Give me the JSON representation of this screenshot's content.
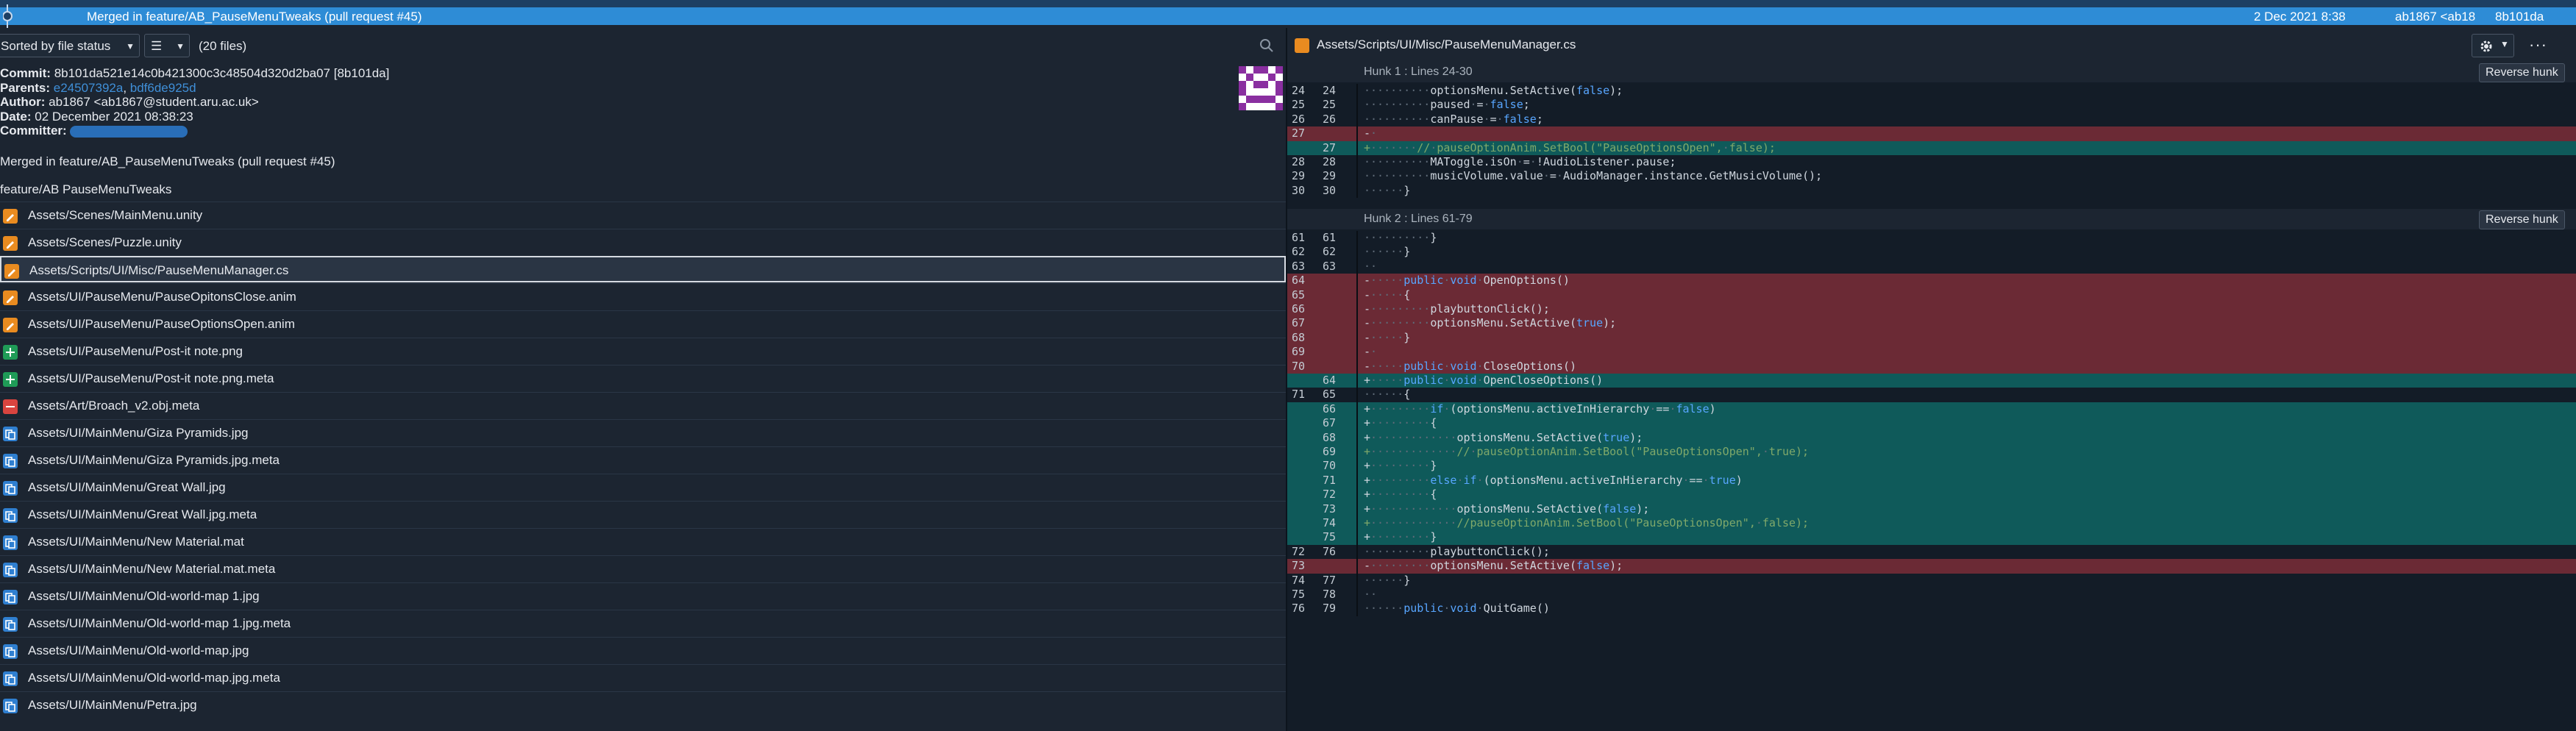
{
  "top_strip": {
    "text": "Merged in feature/AB_PauseMenuTweaks ... for commit ..."
  },
  "commit_bar": {
    "message": "Merged in feature/AB_PauseMenuTweaks (pull request #45)",
    "date": "2 Dec 2021 8:38",
    "author": "ab1867 <ab18",
    "hash": "8b101da"
  },
  "left": {
    "sort_label": "Sorted by file status",
    "view_icon": "list-view-icon",
    "file_count": "(20 files)",
    "meta": {
      "commit_label": "Commit:",
      "commit_value": "8b101da521e14c0b421300c3c48504d320d2ba07 [8b101da]",
      "parents_label": "Parents:",
      "parent1": "e24507392a",
      "parent2": "bdf6de925d",
      "author_label": "Author:",
      "author_value": "ab1867 <ab1867@student.aru.ac.uk>",
      "date_label": "Date:",
      "date_value": "02 December 2021 08:38:23",
      "committer_label": "Committer:"
    },
    "commit_message": "Merged in feature/AB_PauseMenuTweaks (pull request #45)",
    "branch_line": "feature/AB PauseMenuTweaks",
    "files": [
      {
        "status": "modified",
        "name": "Assets/Scenes/MainMenu.unity"
      },
      {
        "status": "modified",
        "name": "Assets/Scenes/Puzzle.unity"
      },
      {
        "status": "modified",
        "name": "Assets/Scripts/UI/Misc/PauseMenuManager.cs"
      },
      {
        "status": "modified",
        "name": "Assets/UI/PauseMenu/PauseOpitonsClose.anim"
      },
      {
        "status": "modified",
        "name": "Assets/UI/PauseMenu/PauseOptionsOpen.anim"
      },
      {
        "status": "added",
        "name": "Assets/UI/PauseMenu/Post-it note.png"
      },
      {
        "status": "added",
        "name": "Assets/UI/PauseMenu/Post-it note.png.meta"
      },
      {
        "status": "removed",
        "name": "Assets/Art/Broach_v2.obj.meta"
      },
      {
        "status": "renamed",
        "name": "Assets/UI/MainMenu/Giza Pyramids.jpg"
      },
      {
        "status": "renamed",
        "name": "Assets/UI/MainMenu/Giza Pyramids.jpg.meta"
      },
      {
        "status": "renamed",
        "name": "Assets/UI/MainMenu/Great Wall.jpg"
      },
      {
        "status": "renamed",
        "name": "Assets/UI/MainMenu/Great Wall.jpg.meta"
      },
      {
        "status": "renamed",
        "name": "Assets/UI/MainMenu/New Material.mat"
      },
      {
        "status": "renamed",
        "name": "Assets/UI/MainMenu/New Material.mat.meta"
      },
      {
        "status": "renamed",
        "name": "Assets/UI/MainMenu/Old-world-map 1.jpg"
      },
      {
        "status": "renamed",
        "name": "Assets/UI/MainMenu/Old-world-map 1.jpg.meta"
      },
      {
        "status": "renamed",
        "name": "Assets/UI/MainMenu/Old-world-map.jpg"
      },
      {
        "status": "renamed",
        "name": "Assets/UI/MainMenu/Old-world-map.jpg.meta"
      },
      {
        "status": "renamed",
        "name": "Assets/UI/MainMenu/Petra.jpg"
      }
    ],
    "selected_index": 2
  },
  "right": {
    "file_path": "Assets/Scripts/UI/Misc/PauseMenuManager.cs",
    "settings_icon": "gear-icon",
    "more_label": "···",
    "hunks": [
      {
        "title": "Hunk 1 : Lines 24-30",
        "button": "Reverse hunk",
        "lines": [
          {
            "t": "ctx",
            "o": "24",
            "n": "24",
            "c": "··········optionsMenu.SetActive(false);"
          },
          {
            "t": "ctx",
            "o": "25",
            "n": "25",
            "c": "··········paused·=·false;"
          },
          {
            "t": "ctx",
            "o": "26",
            "n": "26",
            "c": "··········canPause·=·false;"
          },
          {
            "t": "del",
            "o": "27",
            "n": "",
            "c": "-·"
          },
          {
            "t": "add",
            "o": "",
            "n": "27",
            "c": "+·······//·pauseOptionAnim.SetBool(\"PauseOptionsOpen\",·false);"
          },
          {
            "t": "ctx",
            "o": "28",
            "n": "28",
            "c": "··········MAToggle.isOn·=·!AudioListener.pause;"
          },
          {
            "t": "ctx",
            "o": "29",
            "n": "29",
            "c": "··········musicVolume.value·=·AudioManager.instance.GetMusicVolume();"
          },
          {
            "t": "ctx",
            "o": "30",
            "n": "30",
            "c": "······}"
          }
        ]
      },
      {
        "title": "Hunk 2 : Lines 61-79",
        "button": "Reverse hunk",
        "lines": [
          {
            "t": "ctx",
            "o": "61",
            "n": "61",
            "c": "··········}"
          },
          {
            "t": "ctx",
            "o": "62",
            "n": "62",
            "c": "······}"
          },
          {
            "t": "ctx",
            "o": "63",
            "n": "63",
            "c": "··"
          },
          {
            "t": "del",
            "o": "64",
            "n": "",
            "c": "-·····public·void·OpenOptions()"
          },
          {
            "t": "del",
            "o": "65",
            "n": "",
            "c": "-·····{"
          },
          {
            "t": "del",
            "o": "66",
            "n": "",
            "c": "-·········playbuttonClick();"
          },
          {
            "t": "del",
            "o": "67",
            "n": "",
            "c": "-·········optionsMenu.SetActive(true);"
          },
          {
            "t": "del",
            "o": "68",
            "n": "",
            "c": "-·····}"
          },
          {
            "t": "del",
            "o": "69",
            "n": "",
            "c": "-·"
          },
          {
            "t": "del",
            "o": "70",
            "n": "",
            "c": "-·····public·void·CloseOptions()"
          },
          {
            "t": "add",
            "o": "",
            "n": "64",
            "c": "+·····public·void·OpenCloseOptions()"
          },
          {
            "t": "ctx",
            "o": "71",
            "n": "65",
            "c": "······{"
          },
          {
            "t": "add",
            "o": "",
            "n": "66",
            "c": "+·········if·(optionsMenu.activeInHierarchy·==·false)"
          },
          {
            "t": "add",
            "o": "",
            "n": "67",
            "c": "+·········{"
          },
          {
            "t": "add",
            "o": "",
            "n": "68",
            "c": "+·············optionsMenu.SetActive(true);"
          },
          {
            "t": "add",
            "o": "",
            "n": "69",
            "c": "+·············//·pauseOptionAnim.SetBool(\"PauseOptionsOpen\",·true);"
          },
          {
            "t": "add",
            "o": "",
            "n": "70",
            "c": "+·········}"
          },
          {
            "t": "add",
            "o": "",
            "n": "71",
            "c": "+·········else·if·(optionsMenu.activeInHierarchy·==·true)"
          },
          {
            "t": "add",
            "o": "",
            "n": "72",
            "c": "+·········{"
          },
          {
            "t": "add",
            "o": "",
            "n": "73",
            "c": "+·············optionsMenu.SetActive(false);"
          },
          {
            "t": "add",
            "o": "",
            "n": "74",
            "c": "+·············//pauseOptionAnim.SetBool(\"PauseOptionsOpen\",·false);"
          },
          {
            "t": "add",
            "o": "",
            "n": "75",
            "c": "+·········}"
          },
          {
            "t": "ctx",
            "o": "72",
            "n": "76",
            "c": "··········playbuttonClick();"
          },
          {
            "t": "del",
            "o": "73",
            "n": "",
            "c": "-·········optionsMenu.SetActive(false);"
          },
          {
            "t": "ctx",
            "o": "74",
            "n": "77",
            "c": "······}"
          },
          {
            "t": "ctx",
            "o": "75",
            "n": "78",
            "c": "··"
          },
          {
            "t": "ctx",
            "o": "76",
            "n": "79",
            "c": "······public·void·QuitGame()"
          }
        ]
      }
    ]
  }
}
